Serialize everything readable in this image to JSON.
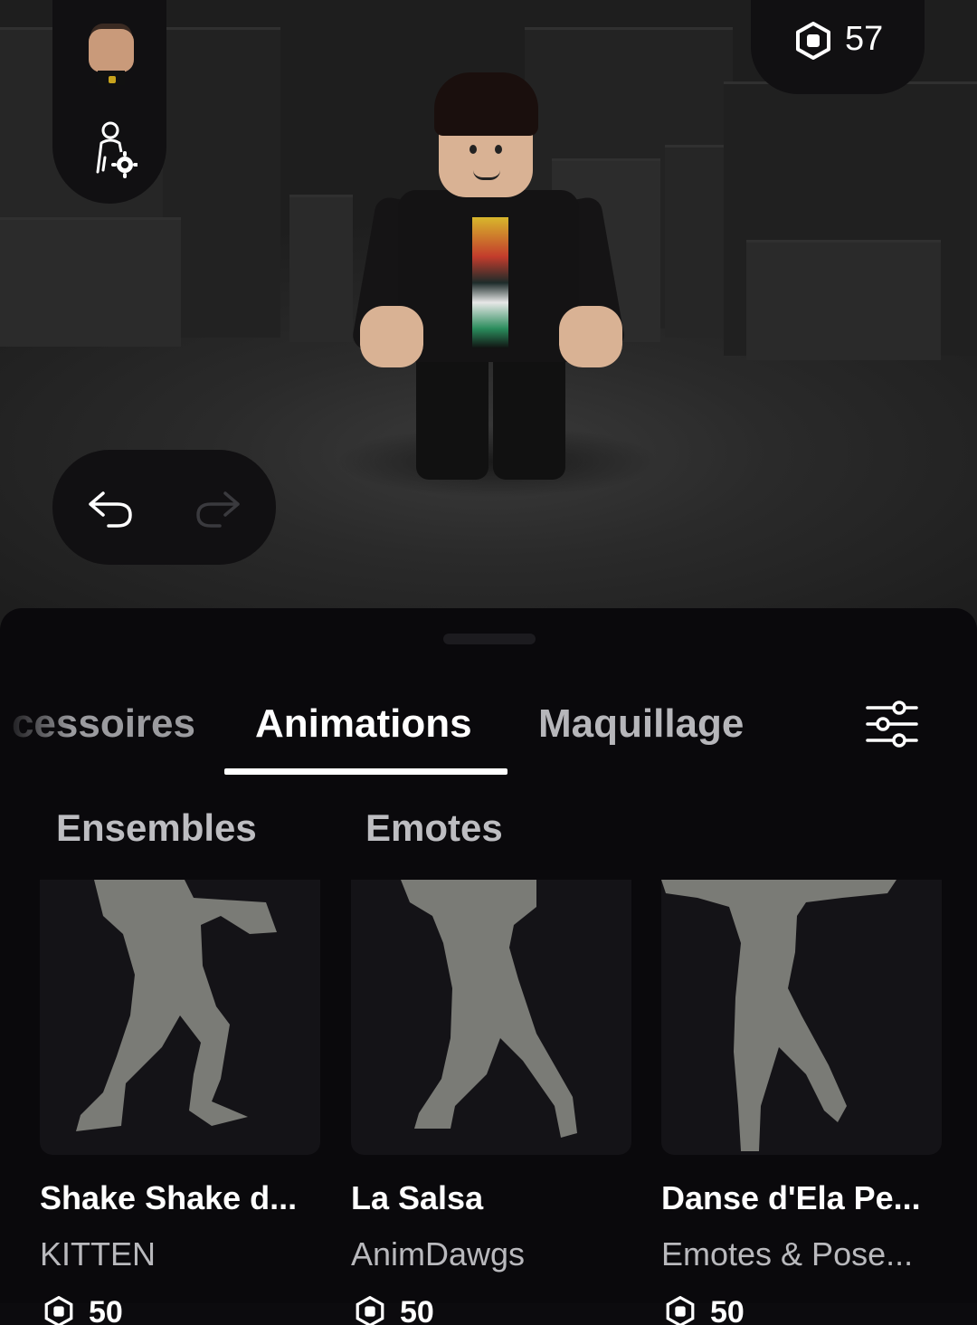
{
  "top_bar": {
    "robux_balance": "57"
  },
  "tabs": [
    {
      "label": "Accessoires",
      "visible_label": "cessoires",
      "active": false
    },
    {
      "label": "Animations",
      "active": true
    },
    {
      "label": "Maquillage",
      "active": false
    }
  ],
  "subtabs": [
    {
      "label": "Ensembles"
    },
    {
      "label": "Emotes"
    }
  ],
  "items": [
    {
      "name": "Shake Shake d...",
      "creator": "KITTEN",
      "price": "50"
    },
    {
      "name": "La Salsa",
      "creator": "AnimDawgs",
      "price": "50"
    },
    {
      "name": "Danse d'Ela Pe...",
      "creator": "Emotes & Pose...",
      "price": "50"
    }
  ],
  "colors": {
    "panel_bg": "#0a090c",
    "active_tab": "#ffffff",
    "inactive_tab": "#b6b6ba",
    "silhouette": "#7a7b76"
  },
  "icons": [
    "robux-icon",
    "avatar-settings-icon",
    "undo-icon",
    "redo-icon",
    "filter-icon"
  ]
}
